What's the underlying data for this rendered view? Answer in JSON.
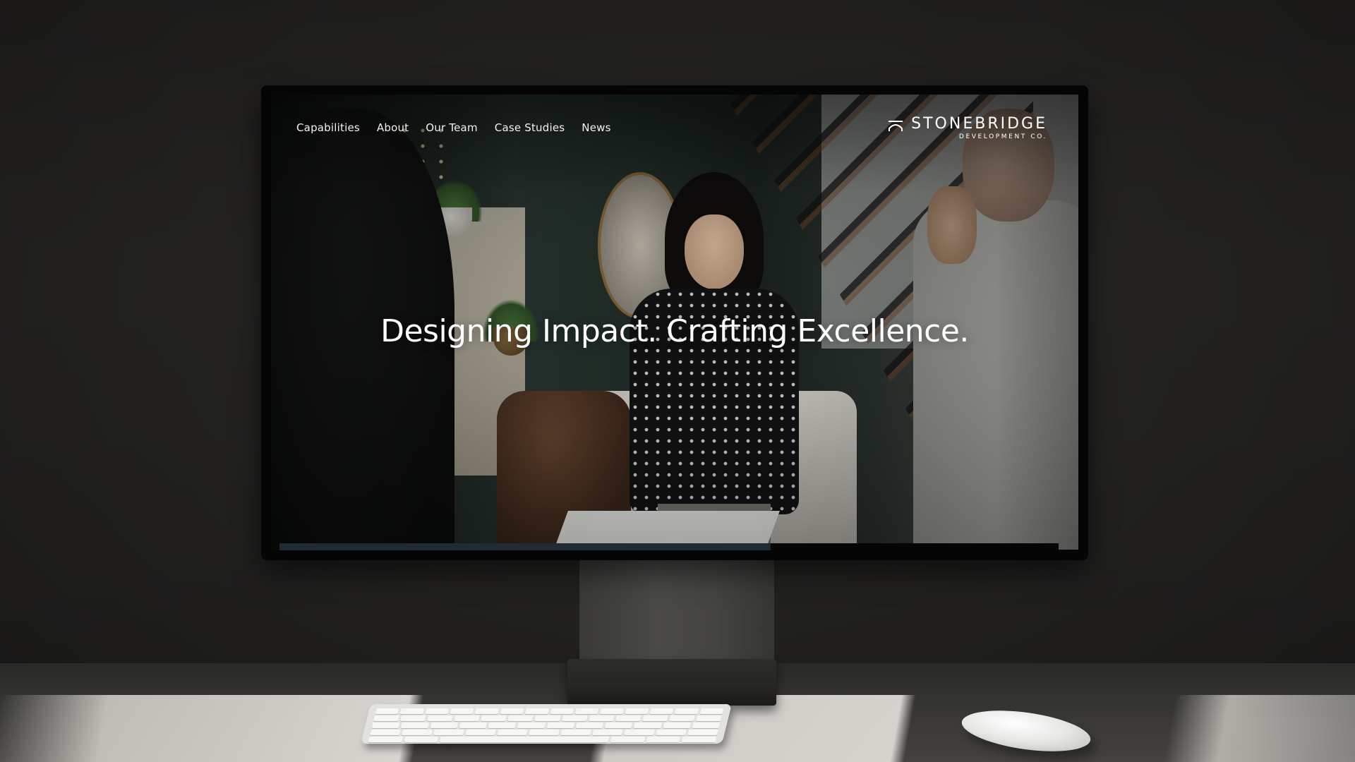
{
  "nav": {
    "items": [
      "Capabilities",
      "About",
      "Our Team",
      "Case Studies",
      "News"
    ]
  },
  "brand": {
    "name": "STONEBRIDGE",
    "subtitle": "DEVELOPMENT CO."
  },
  "hero": {
    "headline": "Designing Impact. Crafting Excellence."
  },
  "slider": {
    "progress": 0.63
  },
  "colors": {
    "text": "#ffffff",
    "monitor_bezel": "#050505",
    "progress_fill": "#1f2a33"
  },
  "icons": [
    "stonebridge-logo-mark-icon"
  ]
}
